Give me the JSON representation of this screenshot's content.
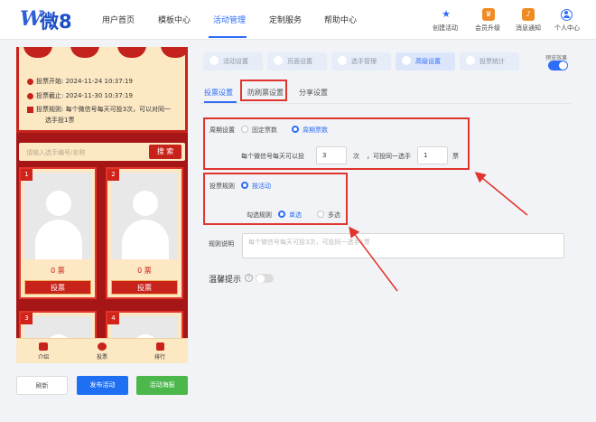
{
  "logo": {
    "mark": "W",
    "text": "微8"
  },
  "nav": {
    "items": [
      "用户首页",
      "模板中心",
      "活动管理",
      "定制服务",
      "帮助中心"
    ],
    "right": [
      {
        "label": "创建活动",
        "icon": "star-icon"
      },
      {
        "label": "会员升级",
        "icon": "vip-crown-icon"
      },
      {
        "label": "消息通知",
        "icon": "bell-icon"
      },
      {
        "label": "个人中心",
        "icon": "user-icon"
      }
    ]
  },
  "preview": {
    "vote_start_label": "投票开始:",
    "vote_start": "2024-11-24 10:37:19",
    "vote_end_label": "投票截止:",
    "vote_end": "2024-11-30 10:37:19",
    "rule_label": "投票规则:",
    "rule_text": "每个微信号每天可投3次，可以对同一",
    "rule_text2": "选手投1票",
    "search_placeholder": "请输入选手编号/名称",
    "search_button": "搜 索",
    "cards": [
      {
        "num": "1",
        "votes": "0 票",
        "vote_button": "投票"
      },
      {
        "num": "2",
        "votes": "0 票",
        "vote_button": "投票"
      },
      {
        "num": "3"
      },
      {
        "num": "4"
      }
    ],
    "tabbar": [
      "介绍",
      "投票",
      "排行"
    ]
  },
  "bottom_buttons": {
    "refresh": "刷新",
    "publish": "发布活动",
    "poster": "活动海报"
  },
  "settings_tabs": [
    "活动设置",
    "页面设置",
    "选手管理",
    "高级设置",
    "投票统计"
  ],
  "active_settings_tab": "高级设置",
  "preview_effect_label": "预览效果",
  "sub_tabs": [
    "投票设置",
    "防刷票设置",
    "分享设置"
  ],
  "cycle": {
    "label": "周期设置",
    "options": [
      "固定票数",
      "周期票数"
    ],
    "selected": "周期票数",
    "line_prefix": "每个微信号每天可以投",
    "times_value": "3",
    "times_unit": "次",
    "line_mid": "，可投同一选手",
    "votes_value": "1",
    "votes_unit": "票"
  },
  "vote_rule": {
    "label": "投票规则",
    "option": "按活动",
    "check_label": "勾选规则",
    "check_options": [
      "单选",
      "多选"
    ],
    "selected": "单选"
  },
  "rule_desc": {
    "label": "规则说明",
    "placeholder": "每个微信号每天可投3次，可投同一选手1票"
  },
  "reminder": {
    "label": "温馨提示",
    "icon": "help-circle-icon"
  },
  "colors": {
    "primary": "#2f6df6",
    "festive_red": "#c8231b",
    "annotation_red": "#e0342c",
    "publish": "#1e6ff2",
    "poster": "#4cb84c"
  }
}
